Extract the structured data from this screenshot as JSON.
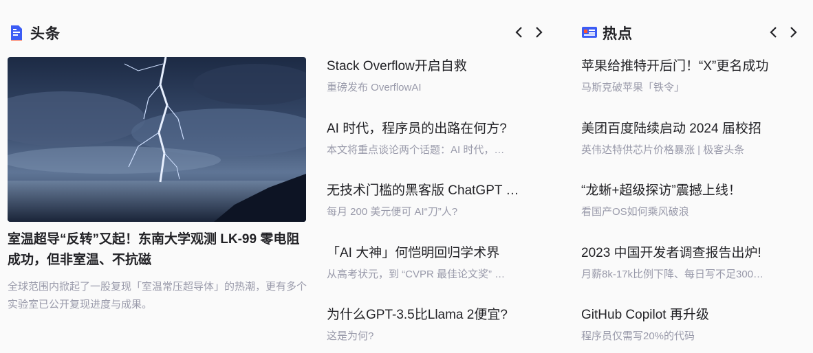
{
  "toutiao": {
    "title": "头条",
    "headline": {
      "title": "室温超导“反转”又起！东南大学观测 LK-99 零电阻成功，但非室温、不抗磁",
      "desc": "全球范围内掀起了一股复现「室温常压超导体」的热潮，更有多个实验室已公开复现进度与成果。"
    },
    "items": [
      {
        "title": "Stack Overflow开启自救",
        "desc": "重磅发布 OverflowAI"
      },
      {
        "title": "AI 时代，程序员的出路在何方?",
        "desc": "本文将重点谈论两个话题：AI 时代，…"
      },
      {
        "title": "无技术门槛的黑客版 ChatGPT …",
        "desc": "每月 200 美元便可 AI“刀”人?"
      },
      {
        "title": "「AI 大神」何恺明回归学术界",
        "desc": "从高考状元，到 “CVPR 最佳论文奖” …"
      },
      {
        "title": "为什么GPT-3.5比Llama 2便宜?",
        "desc": "这是为何?"
      }
    ]
  },
  "redian": {
    "title": "热点",
    "items": [
      {
        "title": "苹果给推特开后门！“X”更名成功",
        "desc": "马斯克破苹果「铁令」"
      },
      {
        "title": "美团百度陆续启动 2024 届校招",
        "desc": "英伟达特供芯片价格暴涨 | 极客头条"
      },
      {
        "title": "“龙蜥+超级探访”震撼上线！",
        "desc": "看国产OS如何乘风破浪"
      },
      {
        "title": "2023 中国开发者调查报告出炉!",
        "desc": "月薪8k-17k比例下降、每日写不足300…"
      },
      {
        "title": "GitHub Copilot 再升级",
        "desc": "程序员仅需写20%的代码"
      }
    ]
  },
  "colors": {
    "accent_blue": "#3b5cf5",
    "accent_red": "#fc5531",
    "text": "#222226",
    "muted": "#999aaa"
  },
  "icons": {
    "toutiao": "document-icon",
    "redian": "news-card-icon",
    "prev": "chevron-left-icon",
    "next": "chevron-right-icon"
  }
}
